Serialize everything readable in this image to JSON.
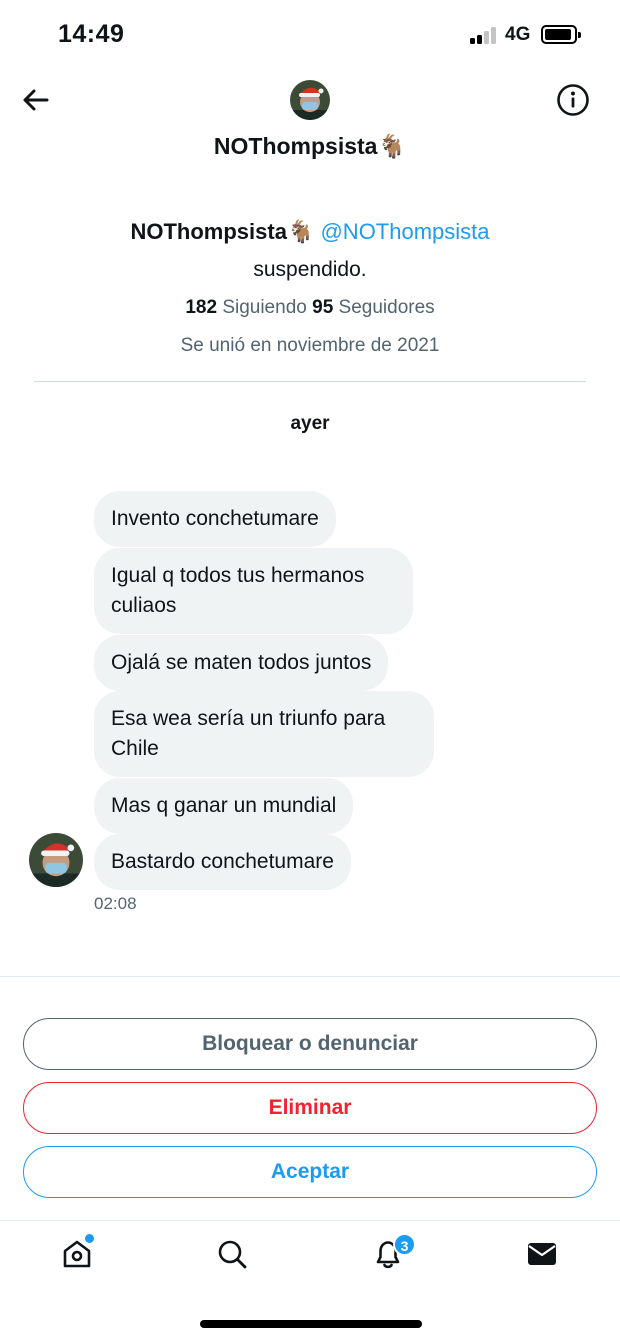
{
  "status_bar": {
    "time": "14:49",
    "network": "4G"
  },
  "header": {
    "display_name": "NOThompsista🐐"
  },
  "profile": {
    "display_name": "NOThompsista🐐",
    "handle": "@NOThompsista",
    "bio": "suspendido.",
    "following_count": "182",
    "following_label": "Siguiendo",
    "followers_count": "95",
    "followers_label": "Seguidores",
    "joined": "Se unió en noviembre de 2021"
  },
  "conversation": {
    "day_label": "ayer",
    "messages": [
      {
        "text": "Invento conchetumare"
      },
      {
        "text": "Igual q todos tus hermanos culiaos"
      },
      {
        "text": "Ojalá se maten todos juntos"
      },
      {
        "text": "Esa wea sería un triunfo para Chile"
      },
      {
        "text": "Mas q ganar un mundial"
      },
      {
        "text": "Bastardo conchetumare"
      }
    ],
    "timestamp": "02:08"
  },
  "actions": {
    "block_report": "Bloquear o denunciar",
    "delete": "Eliminar",
    "accept": "Aceptar"
  },
  "tab_bar": {
    "tabs": [
      "home-icon",
      "search-icon",
      "notifications-icon",
      "messages-icon"
    ],
    "notifications_badge": "3"
  },
  "colors": {
    "accent": "#1d9bf0",
    "danger": "#f4212e",
    "bubble": "#eff3f4",
    "secondary_text": "#536471"
  }
}
